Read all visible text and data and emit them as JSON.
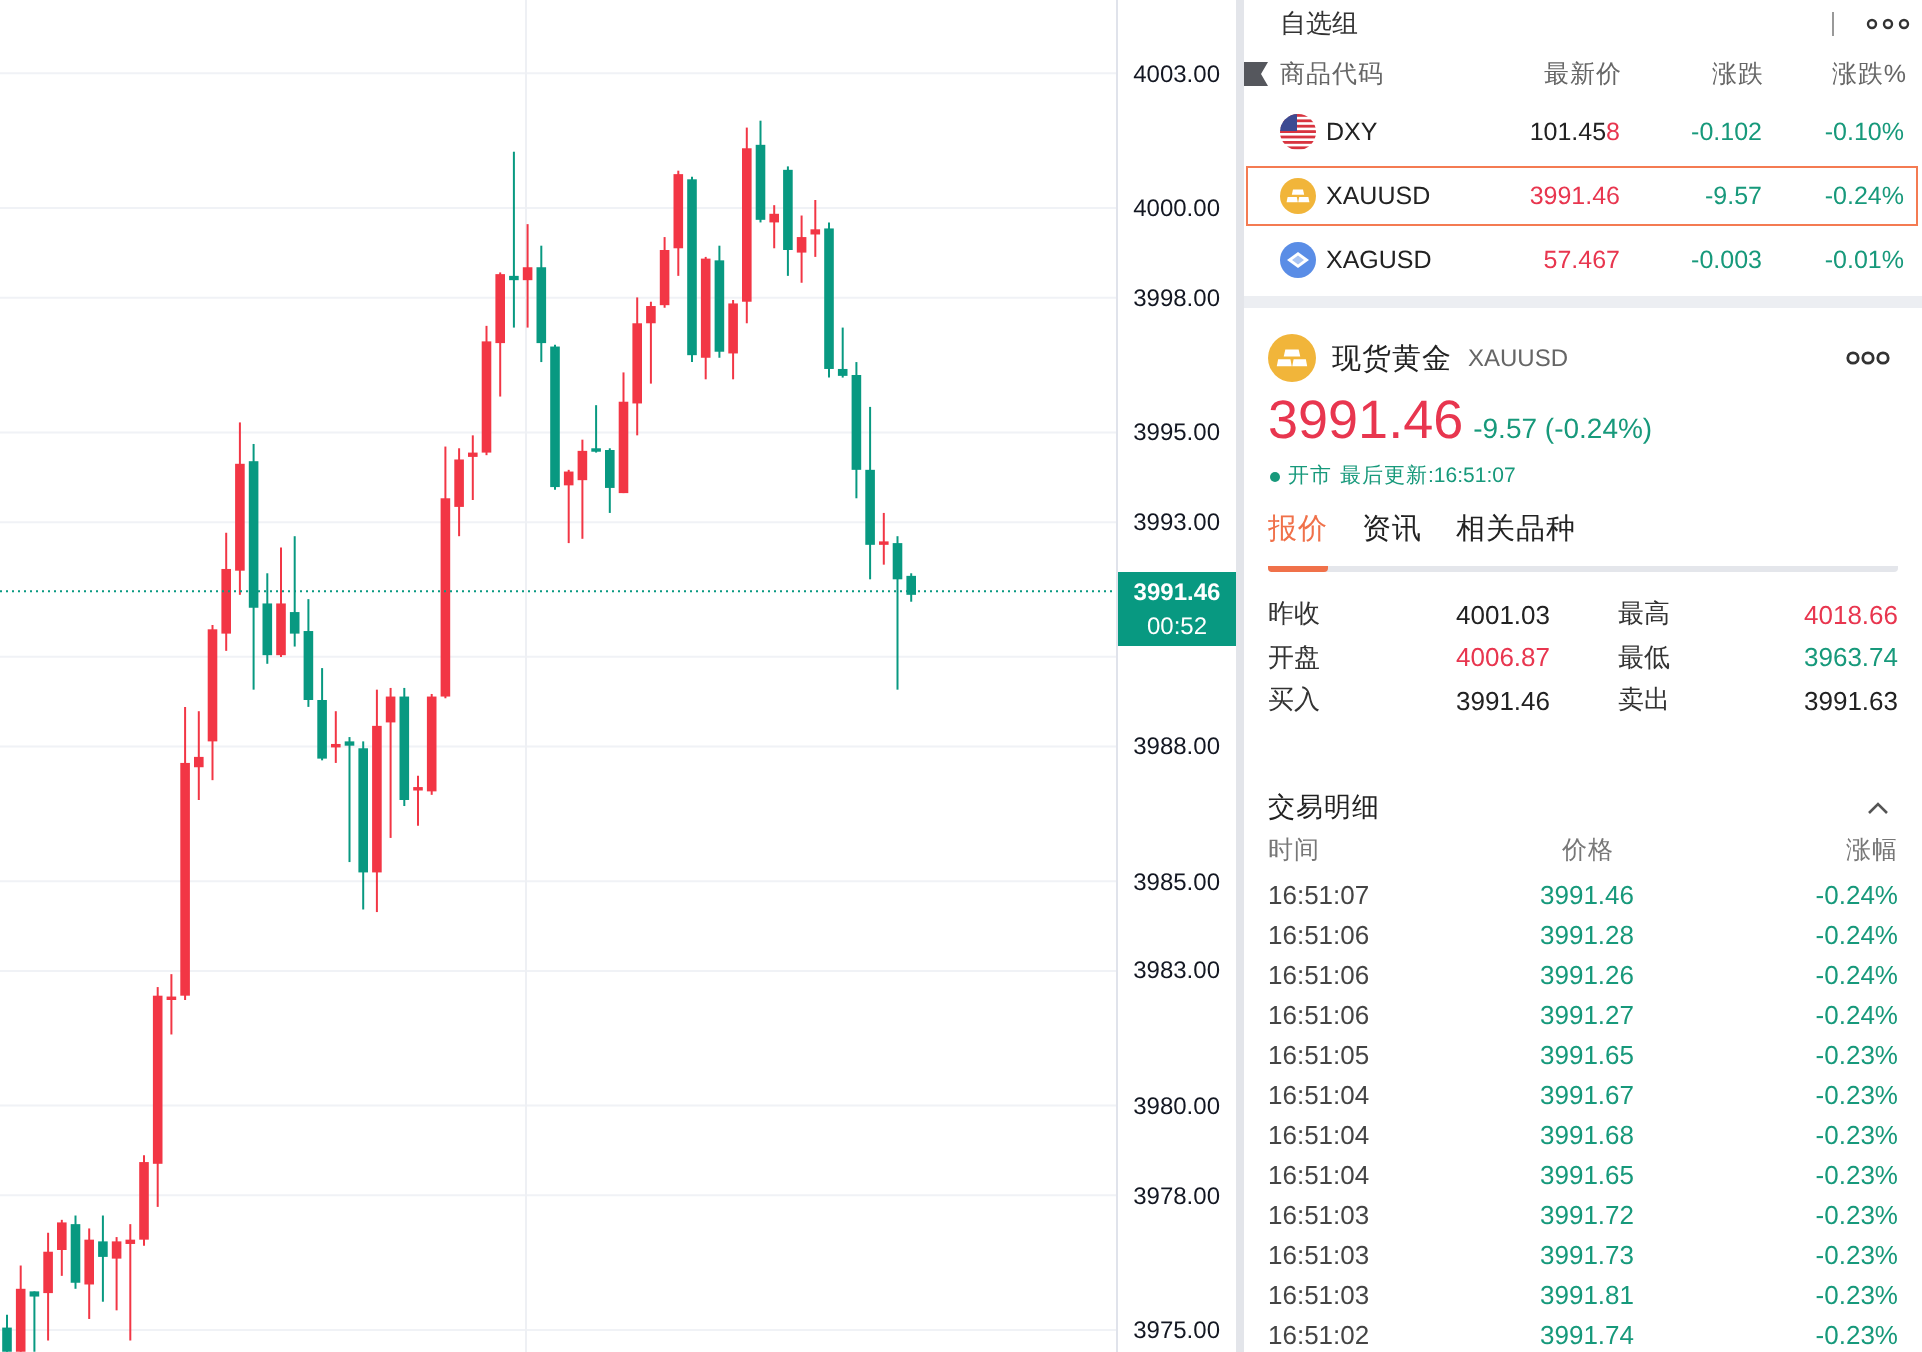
{
  "chart": {
    "price_axis": {
      "ticks": [
        "4003.00",
        "4000.00",
        "3998.00",
        "3995.00",
        "3993.00",
        "3988.00",
        "3985.00",
        "3983.00",
        "3980.00",
        "3978.00",
        "3975.00"
      ],
      "last_price": "3991.46",
      "countdown": "00:52"
    }
  },
  "watchlist": {
    "title": "自选组",
    "columns": [
      "商品代码",
      "最新价",
      "涨跌",
      "涨跌%"
    ],
    "rows": [
      {
        "kind": "flag",
        "symbol": "DXY",
        "price": [
          {
            "text": "101.45",
            "color": "#222222"
          },
          {
            "text": "8",
            "color": "#e8364f"
          }
        ],
        "change": "-0.102",
        "change_pct": "-0.10%",
        "color": "#17997b",
        "selected": false
      },
      {
        "kind": "gold",
        "symbol": "XAUUSD",
        "price": [
          {
            "text": "3991.46",
            "color": "#e8364f"
          }
        ],
        "change": "-9.57",
        "change_pct": "-0.24%",
        "color": "#17997b",
        "selected": true
      },
      {
        "kind": "silver",
        "symbol": "XAGUSD",
        "price": [
          {
            "text": "57.467",
            "color": "#e8364f"
          }
        ],
        "change": "-0.003",
        "change_pct": "-0.01%",
        "color": "#17997b",
        "selected": false
      }
    ]
  },
  "quote": {
    "name": "现货黄金",
    "symbol": "XAUUSD",
    "price": {
      "text": "3991.46",
      "color": "#e8364f"
    },
    "change": {
      "text": "-9.57 (-0.24%)",
      "color": "#17997b"
    },
    "market": {
      "open": true,
      "label": "开市",
      "updated": "最后更新:16:51:07"
    }
  },
  "tabs": [
    {
      "label": "报价",
      "selected": true
    },
    {
      "label": "资讯",
      "selected": false
    },
    {
      "label": "相关品种",
      "selected": false
    }
  ],
  "stats": [
    {
      "label": "昨收",
      "value": "4001.03",
      "color": "#222222"
    },
    {
      "label": "最高",
      "value": "4018.66",
      "color": "#e8364f"
    },
    {
      "label": "开盘",
      "value": "4006.87",
      "color": "#e8364f"
    },
    {
      "label": "最低",
      "value": "3963.74",
      "color": "#17997b"
    },
    {
      "label": "买入",
      "value": "3991.46",
      "color": "#222222"
    },
    {
      "label": "卖出",
      "value": "3991.63",
      "color": "#222222"
    }
  ],
  "trades": {
    "title": "交易明细",
    "expanded": true,
    "columns": [
      "时间",
      "价格",
      "涨幅"
    ],
    "rows": [
      {
        "time": "16:51:07",
        "price": "3991.46",
        "change": "-0.24%",
        "color": "#17997b"
      },
      {
        "time": "16:51:06",
        "price": "3991.28",
        "change": "-0.24%",
        "color": "#17997b"
      },
      {
        "time": "16:51:06",
        "price": "3991.26",
        "change": "-0.24%",
        "color": "#17997b"
      },
      {
        "time": "16:51:06",
        "price": "3991.27",
        "change": "-0.24%",
        "color": "#17997b"
      },
      {
        "time": "16:51:05",
        "price": "3991.65",
        "change": "-0.23%",
        "color": "#17997b"
      },
      {
        "time": "16:51:04",
        "price": "3991.67",
        "change": "-0.23%",
        "color": "#17997b"
      },
      {
        "time": "16:51:04",
        "price": "3991.68",
        "change": "-0.23%",
        "color": "#17997b"
      },
      {
        "time": "16:51:04",
        "price": "3991.65",
        "change": "-0.23%",
        "color": "#17997b"
      },
      {
        "time": "16:51:03",
        "price": "3991.72",
        "change": "-0.23%",
        "color": "#17997b"
      },
      {
        "time": "16:51:03",
        "price": "3991.73",
        "change": "-0.23%",
        "color": "#17997b"
      },
      {
        "time": "16:51:03",
        "price": "3991.81",
        "change": "-0.23%",
        "color": "#17997b"
      },
      {
        "time": "16:51:02",
        "price": "3991.74",
        "change": "-0.23%",
        "color": "#17997b"
      }
    ]
  }
}
